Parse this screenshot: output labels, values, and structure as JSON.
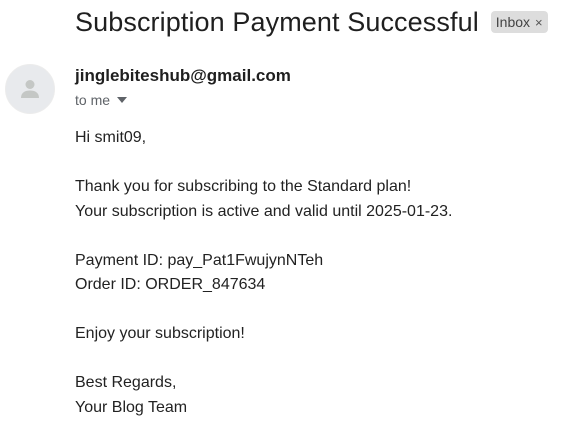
{
  "email": {
    "subject": "Subscription Payment Successful",
    "label_chip": "Inbox",
    "label_chip_close": "×",
    "sender": "jinglebiteshub@gmail.com",
    "recipient": "to me",
    "body": {
      "greeting": "Hi smit09,",
      "line1": "Thank you for subscribing to the Standard plan!",
      "line2": "Your subscription is active and valid until 2025-01-23.",
      "payment_id": "Payment ID: pay_Pat1FwujynNTeh",
      "order_id": "Order ID: ORDER_847634",
      "closing": "Enjoy your subscription!",
      "signoff1": "Best Regards,",
      "signoff2": "Your Blog Team"
    }
  },
  "icons": {
    "avatar": "person-icon",
    "recipient_caret": "caret-down-icon",
    "chip_close": "close-icon"
  },
  "colors": {
    "chip_background": "#dddddd",
    "avatar_background": "#e8eaed",
    "avatar_glyph": "#c4c7c5",
    "secondary_text": "#5f6368"
  }
}
